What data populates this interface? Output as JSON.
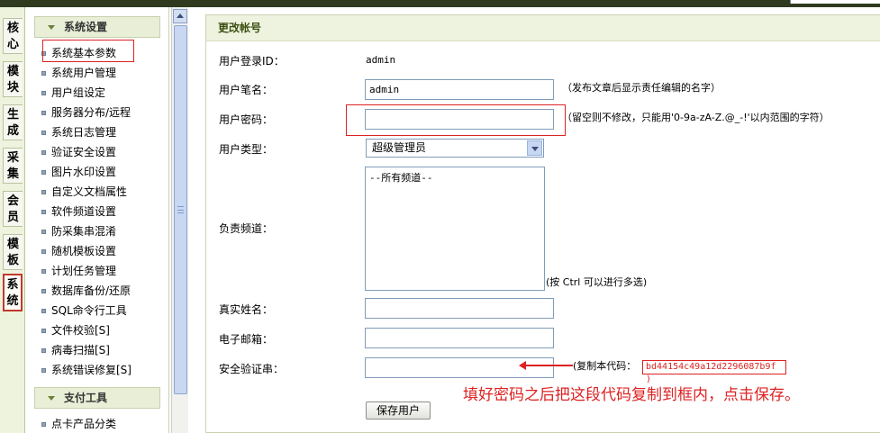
{
  "left_tabs": [
    {
      "label": "核\n心",
      "active": false
    },
    {
      "label": "模\n块",
      "active": false
    },
    {
      "label": "生\n成",
      "active": false
    },
    {
      "label": "采\n集",
      "active": false
    },
    {
      "label": "会\n员",
      "active": false
    },
    {
      "label": "模\n板",
      "active": false
    },
    {
      "label": "系\n统",
      "active": true
    }
  ],
  "menu": {
    "section1_title": "系统设置",
    "items": [
      "系统基本参数",
      "系统用户管理",
      "用户组设定",
      "服务器分布/远程",
      "系统日志管理",
      "验证安全设置",
      "图片水印设置",
      "自定义文档属性",
      "软件频道设置",
      "防采集串混淆",
      "随机模板设置",
      "计划任务管理",
      "数据库备份/还原",
      "SQL命令行工具",
      "文件校验[S]",
      "病毒扫描[S]",
      "系统错误修复[S]"
    ],
    "section2_title": "支付工具",
    "items2": [
      "点卡产品分类"
    ]
  },
  "content": {
    "title": "更改帐号",
    "login_id_label": "用户登录ID：",
    "login_id_value": "admin",
    "penname_label": "用户笔名：",
    "penname_value": "admin",
    "penname_hint": "（发布文章后显示责任编辑的名字）",
    "password_label": "用户密码：",
    "password_value": "",
    "password_hint": "（留空则不修改，只能用'0-9a-zA-Z.@_-!'以内范围的字符）",
    "usertype_label": "用户类型：",
    "usertype_value": "超级管理员",
    "channel_label": "负责频道：",
    "channel_option": "--所有频道--",
    "channel_hint": "(按 Ctrl 可以进行多选)",
    "realname_label": "真实姓名：",
    "email_label": "电子邮箱：",
    "safecode_label": "安全验证串：",
    "copy_label": "(复制本代码：",
    "code_value": "bd44154c49a12d2296087b9f )",
    "annotation": "填好密码之后把这段代码复制到框内，点击保存。",
    "save_button": "保存用户"
  },
  "colors": {
    "accent_red": "#dd2222",
    "header_bg": "#eef3df",
    "header_text": "#3d4f12"
  }
}
